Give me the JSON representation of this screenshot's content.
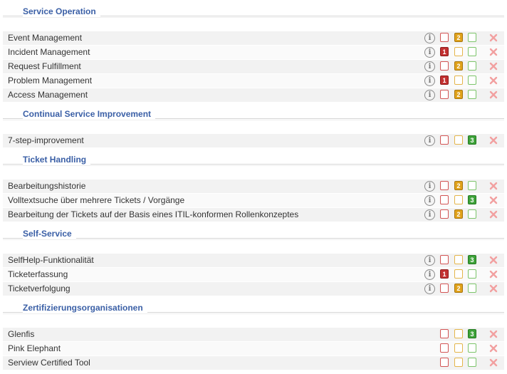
{
  "sections": [
    {
      "title": "Service Operation",
      "items": [
        {
          "label": "Event Management",
          "info": true,
          "level": "2"
        },
        {
          "label": "Incident Management",
          "info": true,
          "level": "1"
        },
        {
          "label": "Request Fulfillment",
          "info": true,
          "level": "2"
        },
        {
          "label": "Problem Management",
          "info": true,
          "level": "1"
        },
        {
          "label": "Access Management",
          "info": true,
          "level": "2"
        }
      ]
    },
    {
      "title": "Continual Service Improvement",
      "items": [
        {
          "label": "7-step-improvement",
          "info": true,
          "level": "3"
        }
      ]
    },
    {
      "title": "Ticket Handling",
      "items": [
        {
          "label": "Bearbeitungshistorie",
          "info": true,
          "level": "2"
        },
        {
          "label": "Volltextsuche über mehrere Tickets / Vorgänge",
          "info": true,
          "level": "3"
        },
        {
          "label": "Bearbeitung der Tickets auf der Basis eines ITIL-konformen Rollenkonzeptes",
          "info": true,
          "level": "2"
        }
      ]
    },
    {
      "title": "Self-Service",
      "items": [
        {
          "label": "SelfHelp-Funktionalität",
          "info": true,
          "level": "3"
        },
        {
          "label": "Ticketerfassung",
          "info": true,
          "level": "1"
        },
        {
          "label": "Ticketverfolgung",
          "info": true,
          "level": "2"
        }
      ]
    },
    {
      "title": "Zertifizierungsorganisationen",
      "items": [
        {
          "label": "Glenfis",
          "info": false,
          "level": "3"
        },
        {
          "label": "Pink Elephant",
          "info": false,
          "level": null
        },
        {
          "label": "Serview Certified Tool",
          "info": false,
          "level": null
        }
      ]
    }
  ],
  "icons": {
    "info": "info-icon",
    "delete": "delete-x-icon"
  },
  "colors": {
    "section_title": "#3a5fa6",
    "level_1": "#c23030",
    "level_2": "#e0a21b",
    "level_3": "#3ea23a",
    "delete": "#f2a0a0"
  }
}
